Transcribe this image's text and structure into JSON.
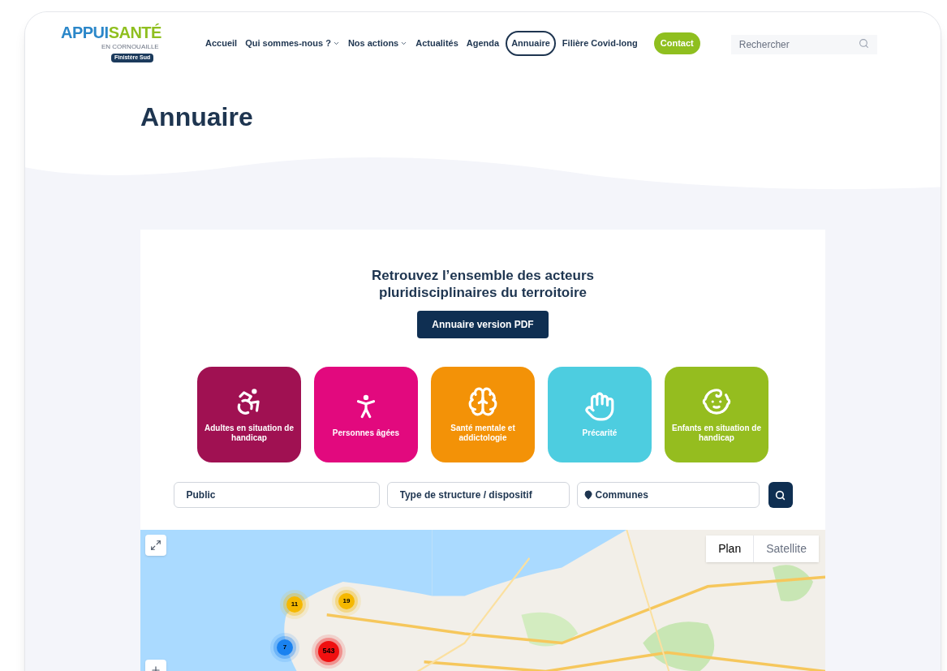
{
  "logo": {
    "brand_left": "APPUI",
    "brand_right": "SANTÉ",
    "tagline": "EN CORNOUAILLE",
    "region": "Finistère Sud"
  },
  "nav": [
    {
      "label": "Accueil",
      "selected": false,
      "has_menu": false
    },
    {
      "label": "Qui sommes-nous ?",
      "selected": false,
      "has_menu": true
    },
    {
      "label": "Nos actions",
      "selected": false,
      "has_menu": true
    },
    {
      "label": "Actualités",
      "selected": false,
      "has_menu": false
    },
    {
      "label": "Agenda",
      "selected": false,
      "has_menu": false
    },
    {
      "label": "Annuaire",
      "selected": true,
      "has_menu": false
    },
    {
      "label": "Filière Covid-long",
      "selected": false,
      "has_menu": false
    }
  ],
  "contact_button": "Contact",
  "search": {
    "placeholder": "Rechercher"
  },
  "page_title": "Annuaire",
  "intro": {
    "heading": "Retrouvez l’ensemble des acteurs pluridisciplinaires du terroitoire",
    "pdf_button": "Annuaire version PDF"
  },
  "categories": [
    {
      "label": "Adultes en situation de handicap",
      "color": "#a01152"
    },
    {
      "label": "Personnes âgées",
      "color": "#e2097e"
    },
    {
      "label": "Santé mentale et addictologie",
      "color": "#f39207"
    },
    {
      "label": "Précarité",
      "color": "#4dcde0"
    },
    {
      "label": "Enfants en situation de handicap",
      "color": "#95bd1f"
    }
  ],
  "filters": [
    {
      "placeholder": "Public",
      "kind": "select"
    },
    {
      "placeholder": "Type de structure / dispositif",
      "kind": "select"
    },
    {
      "placeholder": "Communes",
      "kind": "location"
    }
  ],
  "map": {
    "kind": "picture",
    "view_tabs": [
      {
        "label": "Plan",
        "selected": true
      },
      {
        "label": "Satellite",
        "selected": false
      }
    ],
    "clusters": [
      {
        "count": "11",
        "color": "#f5b800"
      },
      {
        "count": "19",
        "color": "#f5b800"
      },
      {
        "count": "7",
        "color": "#1a82f0"
      },
      {
        "count": "543",
        "color": "#f01010"
      }
    ]
  }
}
